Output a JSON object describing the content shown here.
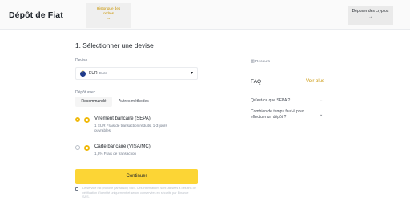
{
  "header": {
    "title": "Dépôt de Fiat",
    "history_tab": {
      "line1": "Historique des",
      "line2": "ordres",
      "arrow": "→"
    },
    "crypto_button": {
      "label": "Déposer des cryptos",
      "arrow": "→"
    }
  },
  "form": {
    "step_title": "1. Sélectionner une devise",
    "currency_label": "Devise",
    "currency": {
      "code": "EUR",
      "name": "Euro",
      "icon": "euro-flag-icon"
    },
    "deposit_label": "Dépôt avec",
    "tabs": [
      {
        "label": "Recommandé",
        "active": true
      },
      {
        "label": "Autres méthodes",
        "active": false
      }
    ],
    "methods": [
      {
        "title": "Virement bancaire (SEPA)",
        "desc_line1": "1 EUR Frais de transaction réduits, 1-3 jours",
        "desc_line2": "ouvrables",
        "selected": true
      },
      {
        "title": "Carte bancaire (VISA/MC)",
        "desc_line1": "1,8% Frais de transaction",
        "desc_line2": "",
        "selected": false
      }
    ],
    "continue_label": "Continuer",
    "disclaimer": "Le service est proposé par Nilsoly SAS. Ces informations sont utilisées à des fins de vérification d'identité uniquement et seront conservées en sécurité par Binance SAS."
  },
  "sidebar": {
    "resources_label": "Recours",
    "faq_label": "FAQ",
    "see_more": "Voir plus",
    "questions": [
      {
        "line1": "Qu'est-ce que SEPA ?",
        "line2": "",
        "line3": ""
      },
      {
        "line1": "Combien de temps faut-il pour",
        "line2": "effectuer un dépôt ?",
        "line3": ""
      }
    ]
  },
  "colors": {
    "accent": "#fcd535",
    "link": "#c99400",
    "text": "#1e2329",
    "muted": "#707a8a"
  }
}
